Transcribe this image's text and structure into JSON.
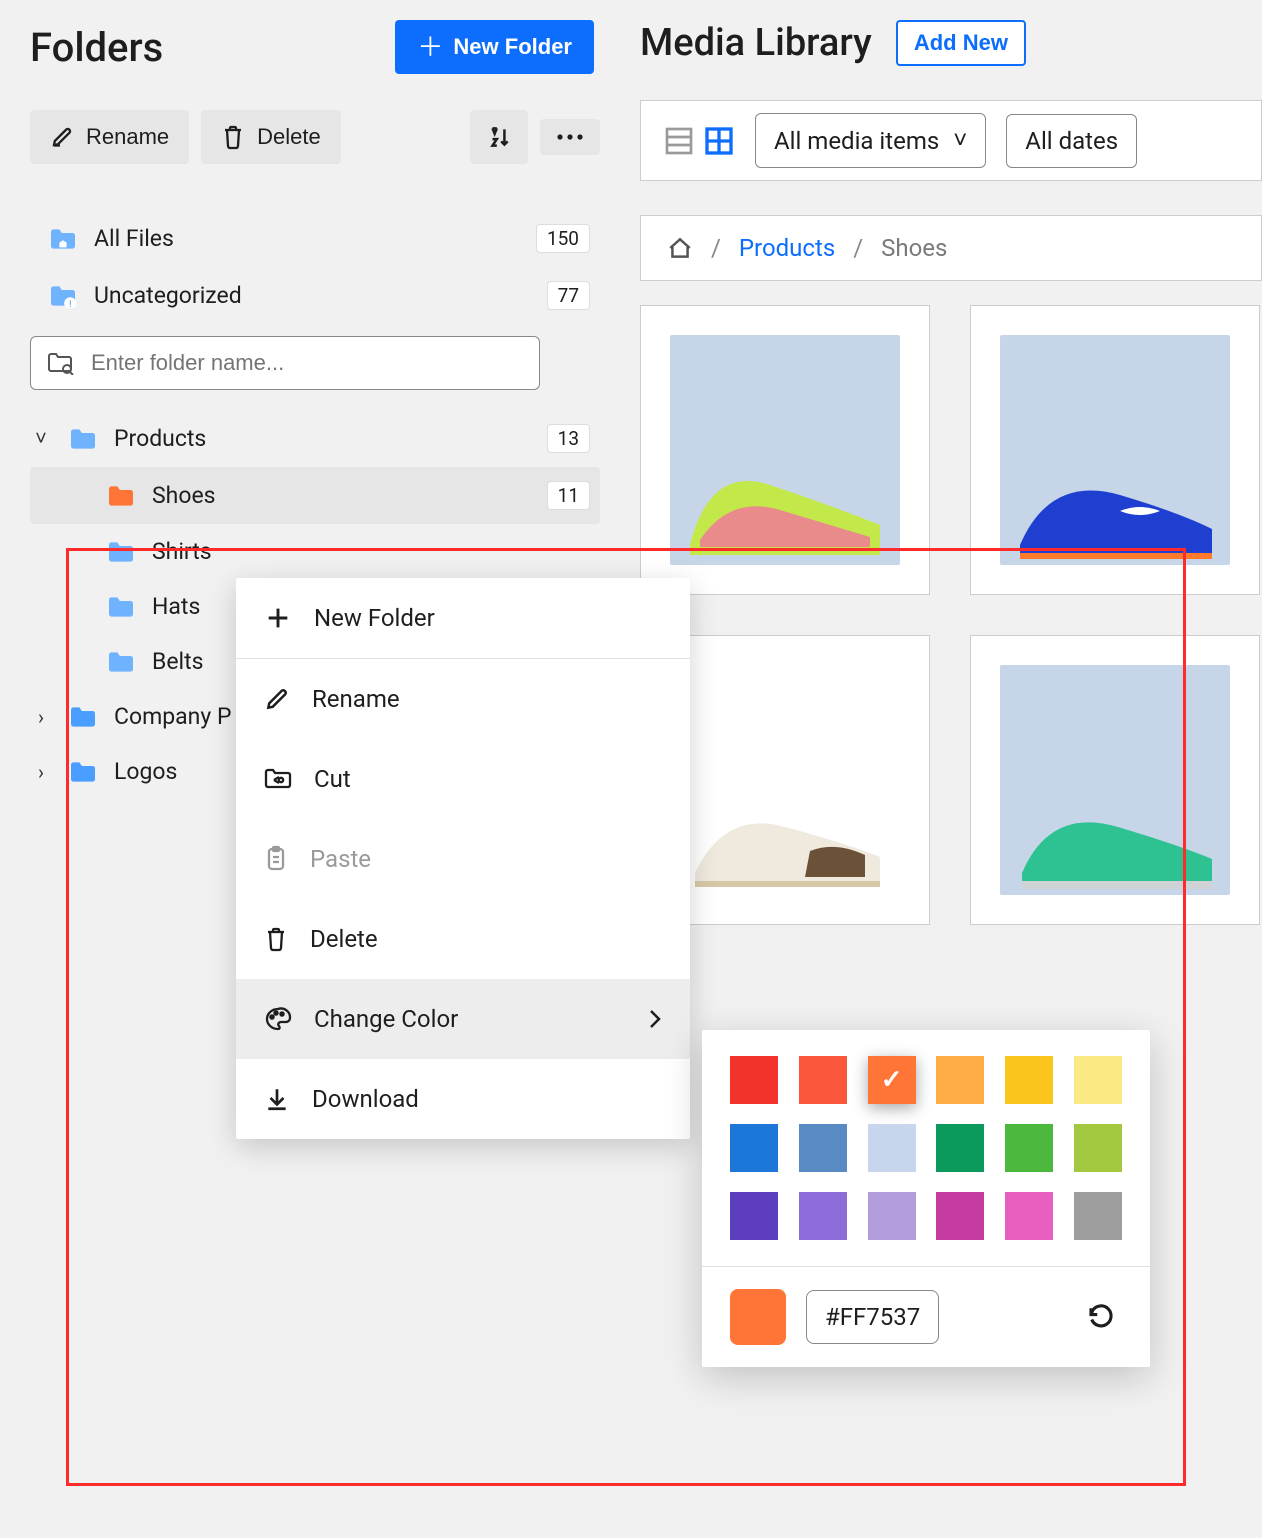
{
  "sidebar": {
    "title": "Folders",
    "new_folder_label": "New Folder",
    "toolbar": {
      "rename": "Rename",
      "delete": "Delete"
    },
    "all_files": {
      "label": "All Files",
      "count": "150"
    },
    "uncategorized": {
      "label": "Uncategorized",
      "count": "77"
    },
    "search_placeholder": "Enter folder name...",
    "tree": {
      "products": {
        "label": "Products",
        "count": "13"
      },
      "shoes": {
        "label": "Shoes",
        "count": "11",
        "color": "#FF7537"
      },
      "shirts": {
        "label": "Shirts"
      },
      "hats": {
        "label": "Hats"
      },
      "belts": {
        "label": "Belts"
      },
      "company": {
        "label": "Company P"
      },
      "logos": {
        "label": "Logos"
      }
    }
  },
  "main": {
    "title": "Media Library",
    "add_new": "Add New",
    "filters": {
      "media_type": "All media items",
      "date": "All dates"
    },
    "breadcrumb": {
      "products": "Products",
      "current": "Shoes"
    }
  },
  "context_menu": {
    "new_folder": "New Folder",
    "rename": "Rename",
    "cut": "Cut",
    "paste": "Paste",
    "delete": "Delete",
    "change_color": "Change Color",
    "download": "Download"
  },
  "color_picker": {
    "swatches": [
      "#F3322C",
      "#FA573C",
      "#FF7537",
      "#FFAD46",
      "#FAC51C",
      "#FBE983",
      "#1C77D9",
      "#5A8AC3",
      "#C7D6EC",
      "#0B9A5B",
      "#4CB83E",
      "#A2C940",
      "#5C3EBE",
      "#8D6CD9",
      "#B39DDB",
      "#C43CA0",
      "#E85FC0",
      "#9E9E9E"
    ],
    "selected_index": 2,
    "current_hex": "#FF7537"
  }
}
